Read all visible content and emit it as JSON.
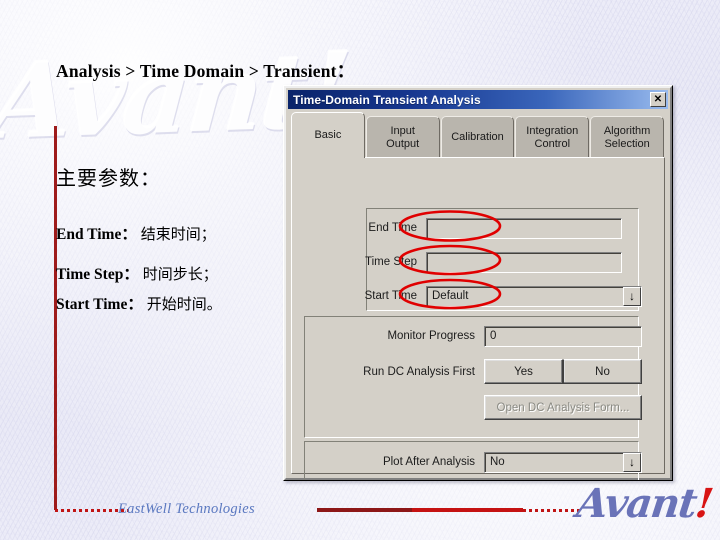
{
  "slide": {
    "heading": "Analysis > Time Domain > Transient：",
    "subhead": "主要参数：",
    "watermark_text": "Avant!",
    "params": [
      {
        "term": "End Time",
        "sep": "：",
        "desc": "结束时间；"
      },
      {
        "term": "Time Step",
        "sep": "：",
        "desc": "时间步长；"
      },
      {
        "term": "Start Time",
        "sep": "：",
        "desc": "开始时间。"
      }
    ]
  },
  "dialog": {
    "title": "Time-Domain Transient Analysis",
    "close_label": "✕",
    "tabs": [
      {
        "label": "Basic",
        "selected": true
      },
      {
        "label": "Input\nOutput",
        "selected": false
      },
      {
        "label": "Calibration",
        "selected": false
      },
      {
        "label": "Integration\nControl",
        "selected": false
      },
      {
        "label": "Algorithm\nSelection",
        "selected": false
      }
    ],
    "fields": {
      "end_time_label": "End Time",
      "end_time_value": "",
      "time_step_label": "Time Step",
      "time_step_value": "",
      "start_time_label": "Start Time",
      "start_time_value": "Default",
      "monitor_progress_label": "Monitor Progress",
      "monitor_progress_value": "0",
      "run_dc_label": "Run DC Analysis First",
      "run_dc_yes": "Yes",
      "run_dc_no": "No",
      "open_dc_form_label": "Open DC Analysis Form...",
      "plot_after_label": "Plot After Analysis",
      "plot_after_value": "No",
      "dropdown_arrow": "↓"
    }
  },
  "footer": {
    "company": "EastWell Technologies",
    "logo": "Avant",
    "logo_bang": "!"
  },
  "colors": {
    "accent_red": "#9e1b1b",
    "annotation_red": "#e00000",
    "logo_blue": "#6a73b8",
    "title_blue": "#0a246a",
    "dialog_face": "#d4d0c8",
    "background": "#eeeef9"
  }
}
